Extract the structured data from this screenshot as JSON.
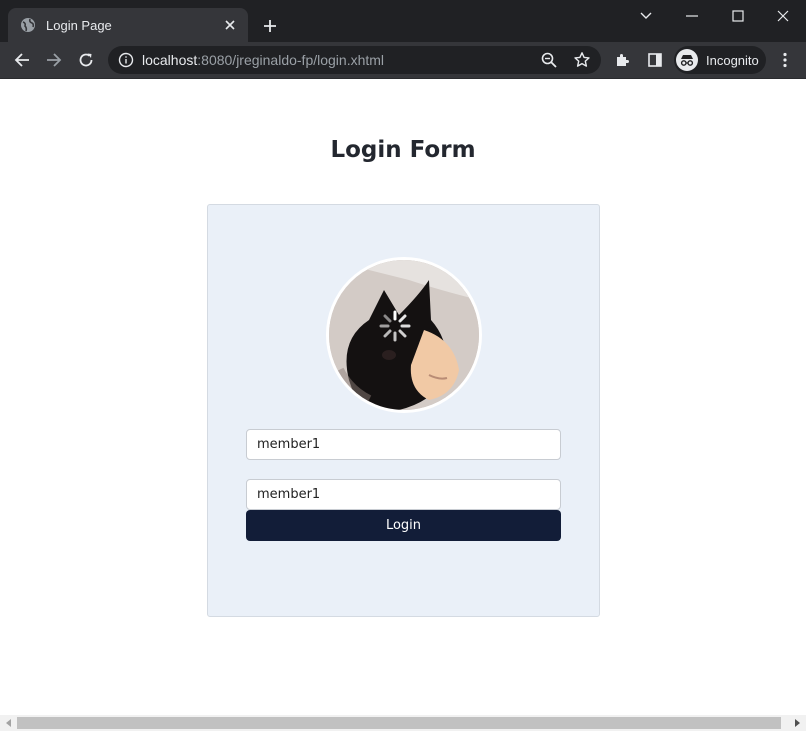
{
  "browser": {
    "tab_title": "Login Page",
    "url_host": "localhost",
    "url_rest": ":8080/jreginaldo-fp/login.xhtml",
    "profile_label": "Incognito"
  },
  "page": {
    "title": "Login Form",
    "avatar_alt": "",
    "username_value": "member1",
    "password_value": "member1",
    "login_label": "Login"
  },
  "colors": {
    "card_bg": "#eaf0f8",
    "button_bg": "#121d38",
    "chrome_dark": "#202124"
  }
}
